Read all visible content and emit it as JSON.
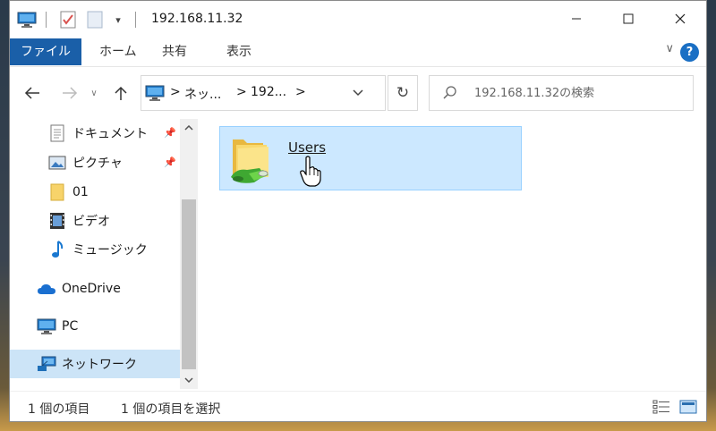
{
  "window": {
    "title": "192.168.11.32"
  },
  "ribbon": {
    "tabs": [
      "ファイル",
      "ホーム",
      "共有",
      "表示"
    ],
    "help_label": "?",
    "collapse_label": "∨"
  },
  "address": {
    "crumbs": [
      "ネッ...",
      "192..."
    ],
    "separator": ">"
  },
  "search": {
    "placeholder": "192.168.11.32の検索"
  },
  "nav_pane": {
    "items": [
      {
        "label": "ドキュメント",
        "icon": "document-icon",
        "pinned": true
      },
      {
        "label": "ピクチャ",
        "icon": "picture-icon",
        "pinned": true
      },
      {
        "label": "01",
        "icon": "folder-icon",
        "pinned": false
      },
      {
        "label": "ビデオ",
        "icon": "video-icon",
        "pinned": false
      },
      {
        "label": "ミュージック",
        "icon": "music-icon",
        "pinned": false
      },
      {
        "label": "OneDrive",
        "icon": "cloud-icon",
        "pinned": false
      },
      {
        "label": "PC",
        "icon": "computer-icon",
        "pinned": false
      },
      {
        "label": "ネットワーク",
        "icon": "network-icon",
        "pinned": false,
        "selected": true
      }
    ]
  },
  "content": {
    "items": [
      {
        "label": "Users",
        "icon": "shared-folder-icon",
        "selected": true
      }
    ]
  },
  "status": {
    "item_count": "1 個の項目",
    "selected_count": "1 個の項目を選択"
  },
  "colors": {
    "file_tab": "#1a5fa8",
    "selection": "#cce8ff",
    "selection_border": "#99d1ff",
    "nav_selected": "#cce4f7"
  }
}
